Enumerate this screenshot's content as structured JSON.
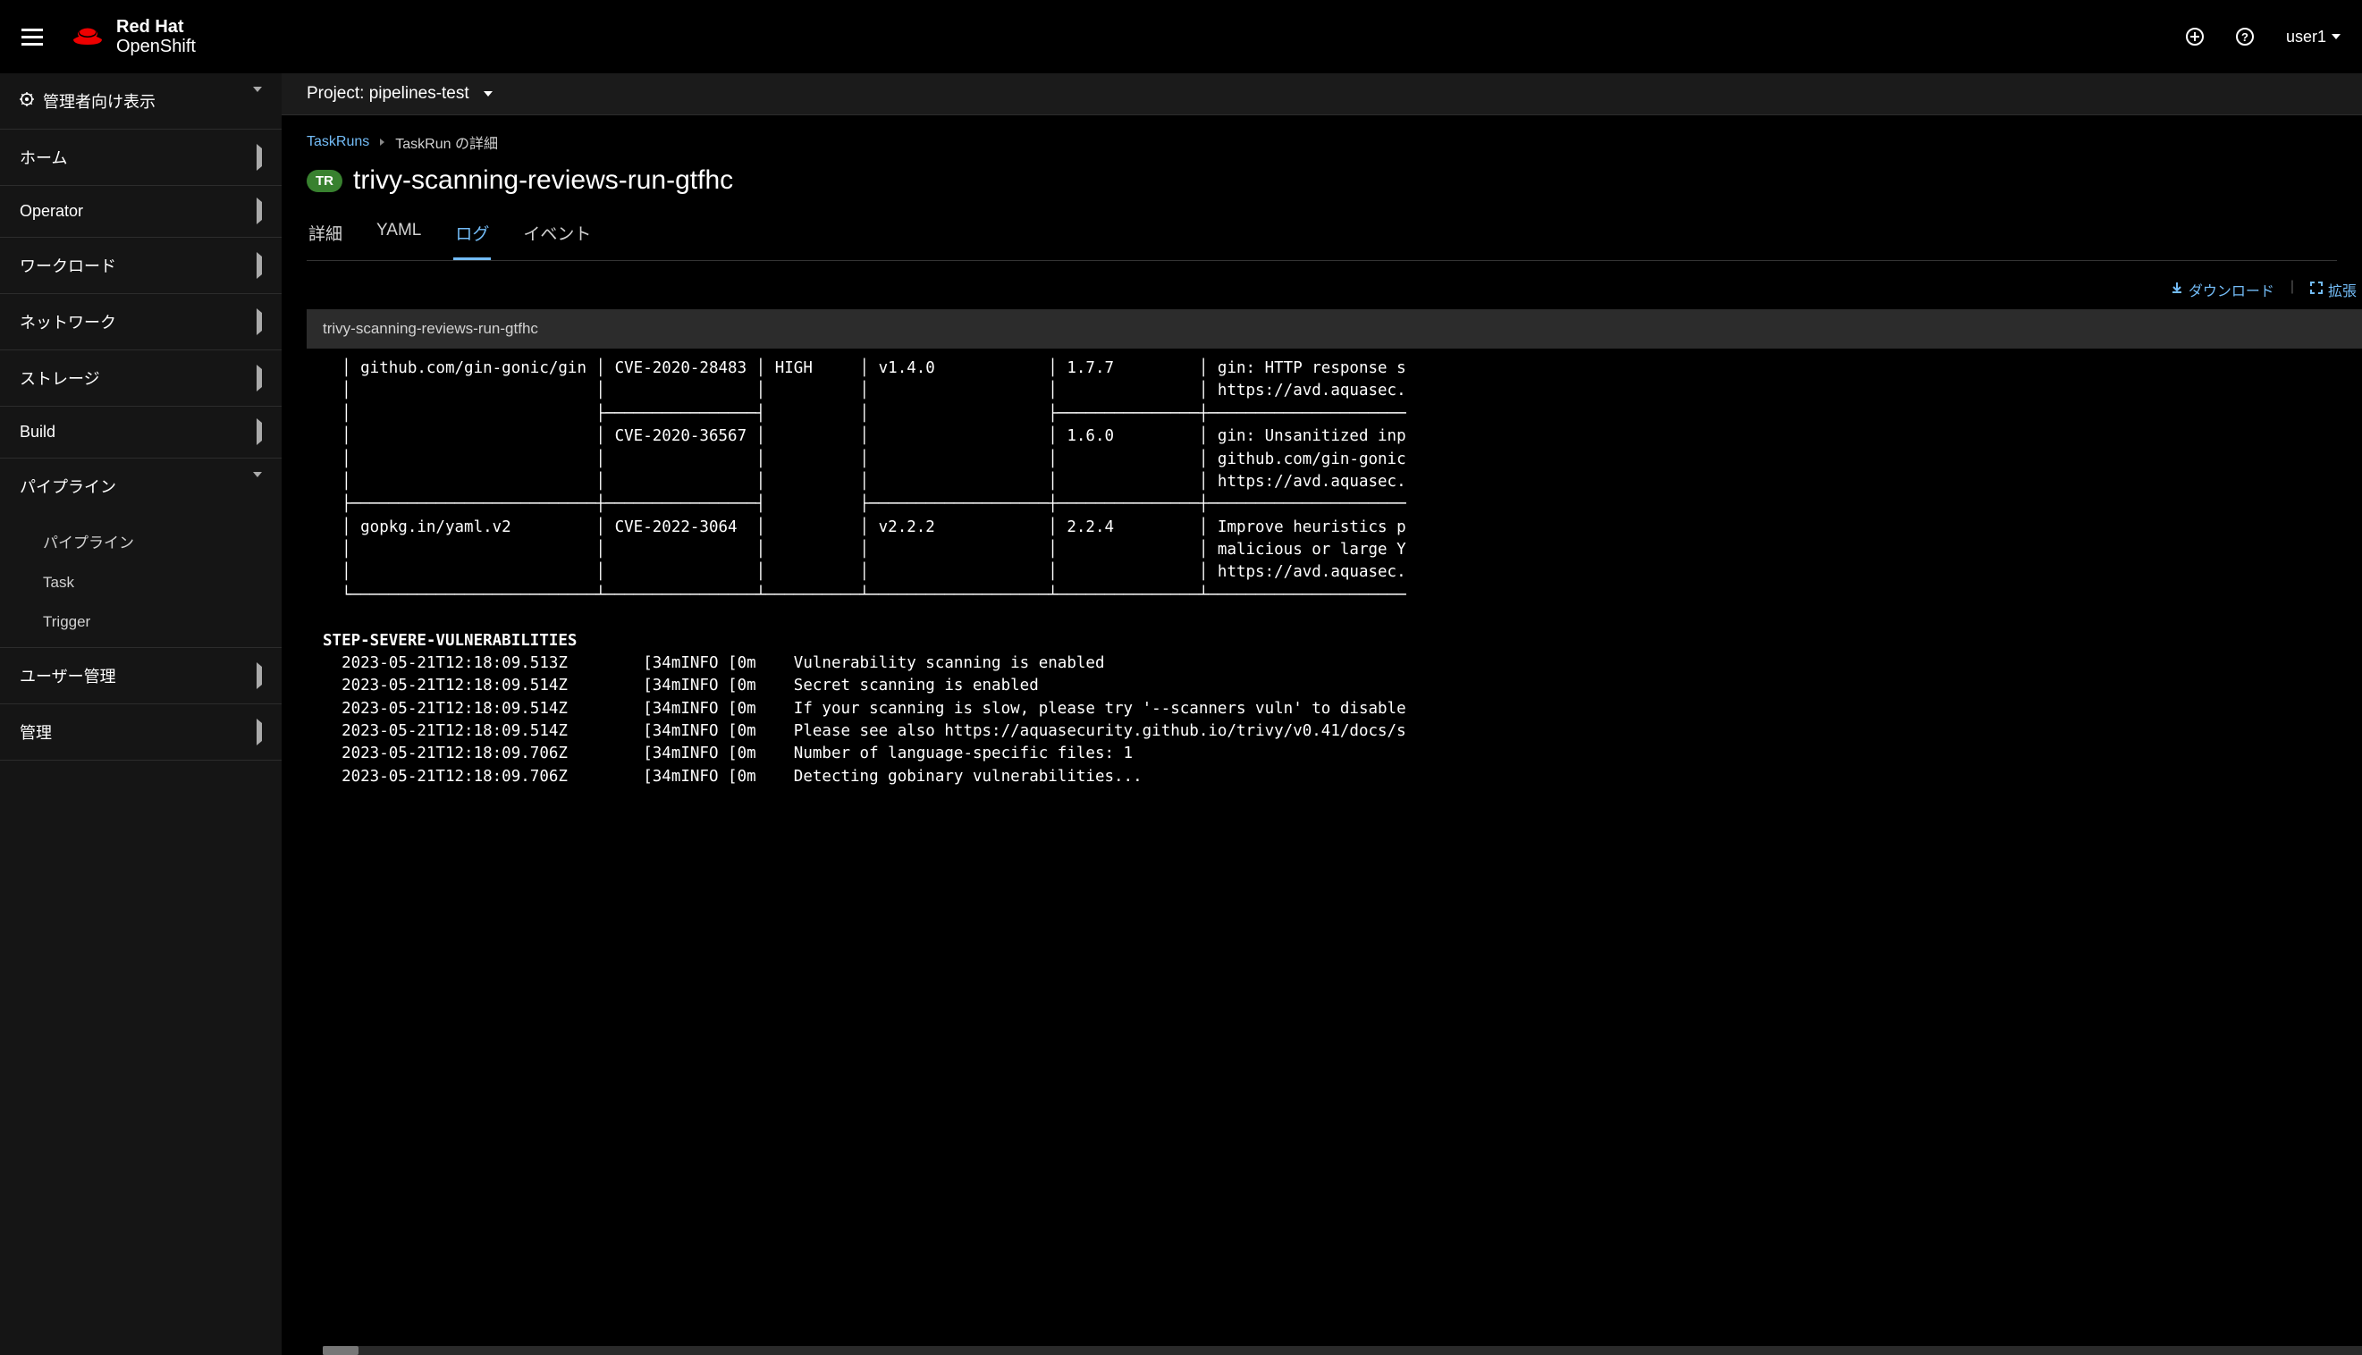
{
  "brand": {
    "line1": "Red Hat",
    "line2": "OpenShift"
  },
  "masthead": {
    "user": "user1"
  },
  "sidebar": {
    "perspective": "管理者向け表示",
    "items": [
      {
        "label": "ホーム"
      },
      {
        "label": "Operator"
      },
      {
        "label": "ワークロード"
      },
      {
        "label": "ネットワーク"
      },
      {
        "label": "ストレージ"
      },
      {
        "label": "Build"
      },
      {
        "label": "パイプライン",
        "expanded": true,
        "children": [
          "パイプライン",
          "Task",
          "Trigger"
        ]
      },
      {
        "label": "ユーザー管理"
      },
      {
        "label": "管理"
      }
    ]
  },
  "project": {
    "prefix": "Project:",
    "name": "pipelines-test"
  },
  "breadcrumb": {
    "root": "TaskRuns",
    "current": "TaskRun の詳細"
  },
  "page": {
    "badge": "TR",
    "title": "trivy-scanning-reviews-run-gtfhc"
  },
  "tabs": [
    "詳細",
    "YAML",
    "ログ",
    "イベント"
  ],
  "active_tab": "ログ",
  "log_toolbar": {
    "download": "ダウンロード",
    "expand": "拡張"
  },
  "log": {
    "title": "trivy-scanning-reviews-run-gtfhc",
    "step_label": "STEP-SEVERE-VULNERABILITIES",
    "table_rows": [
      "│ github.com/gin-gonic/gin │ CVE-2020-28483 │ HIGH     │ v1.4.0            │ 1.7.7         │ gin: HTTP response s",
      "│                          │                │          │                   │               │ https://avd.aquasec.",
      "│                          ├────────────────┤          │                   ├───────────────┼─────────────────────",
      "│                          │ CVE-2020-36567 │          │                   │ 1.6.0         │ gin: Unsanitized inp",
      "│                          │                │          │                   │               │ github.com/gin-gonic",
      "│                          │                │          │                   │               │ https://avd.aquasec.",
      "├──────────────────────────┼────────────────┤          ├───────────────────┼───────────────┼─────────────────────",
      "│ gopkg.in/yaml.v2         │ CVE-2022-3064  │          │ v2.2.2            │ 2.2.4         │ Improve heuristics p",
      "│                          │                │          │                   │               │ malicious or large Y",
      "│                          │                │          │                   │               │ https://avd.aquasec.",
      "└──────────────────────────┴────────────────┴──────────┴───────────────────┴───────────────┴─────────────────────"
    ],
    "lines": [
      "  2023-05-21T12:18:09.513Z        [34mINFO [0m    Vulnerability scanning is enabled",
      "  2023-05-21T12:18:09.514Z        [34mINFO [0m    Secret scanning is enabled",
      "  2023-05-21T12:18:09.514Z        [34mINFO [0m    If your scanning is slow, please try '--scanners vuln' to disable",
      "  2023-05-21T12:18:09.514Z        [34mINFO [0m    Please see also https://aquasecurity.github.io/trivy/v0.41/docs/s",
      "  2023-05-21T12:18:09.706Z        [34mINFO [0m    Number of language-specific files: 1",
      "  2023-05-21T12:18:09.706Z        [34mINFO [0m    Detecting gobinary vulnerabilities..."
    ]
  }
}
